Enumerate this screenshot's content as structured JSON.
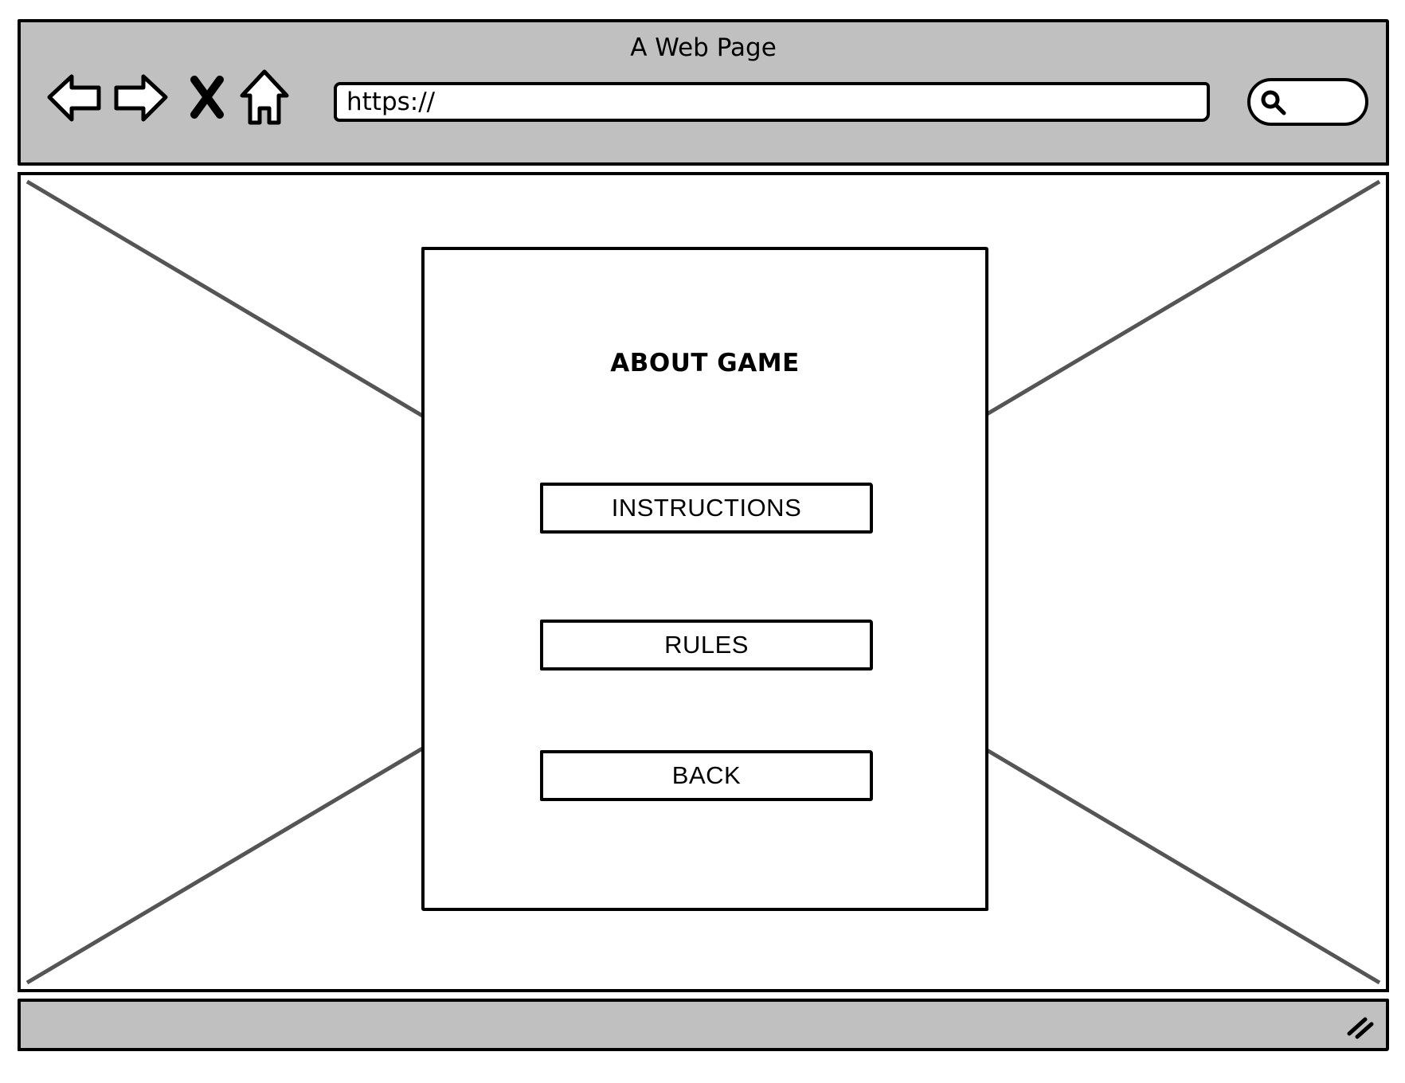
{
  "browser": {
    "window_title": "A Web Page",
    "url": "https://",
    "toolbar_icons": [
      "back-arrow-icon",
      "forward-arrow-icon",
      "stop-icon",
      "home-icon",
      "search-icon"
    ]
  },
  "content": {
    "background_placeholder": "image-placeholder-cross",
    "panel": {
      "title": "ABOUT GAME",
      "buttons": [
        {
          "label": "INSTRUCTIONS"
        },
        {
          "label": "RULES"
        },
        {
          "label": "BACK"
        }
      ]
    }
  },
  "status_bar": {
    "resize_icon": "resize-grip-icon"
  },
  "colors": {
    "chrome": "#c0c0c0",
    "stroke": "#000000",
    "placeholder_line": "#555555",
    "background": "#ffffff"
  }
}
